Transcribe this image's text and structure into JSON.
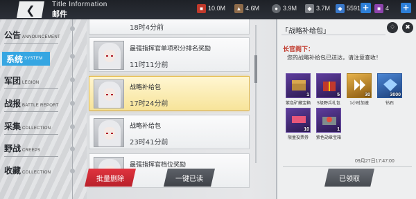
{
  "header": {
    "title_en": "Title Information",
    "title_cn": "邮件",
    "resources": [
      {
        "name": "resource-1",
        "value": "10.0M",
        "icon": "fuel-icon",
        "color": "#c0392b"
      },
      {
        "name": "resource-2",
        "value": "4.6M",
        "icon": "ammo-icon",
        "color": "#8e6b4a"
      },
      {
        "name": "resource-3",
        "value": "3.9M",
        "icon": "steel-icon",
        "color": "#666a70"
      },
      {
        "name": "resource-4",
        "value": "3.7M",
        "icon": "alloy-icon",
        "color": "#7c7f85"
      },
      {
        "name": "resource-5",
        "value": "5591",
        "icon": "crystal-icon",
        "color": "#3a78c9"
      },
      {
        "name": "resource-6",
        "value": "4",
        "icon": "ticket-icon",
        "color": "#8e44ad"
      }
    ]
  },
  "menu": {
    "items": [
      {
        "cn": "公告",
        "en": "ANNOUNCEMENT"
      },
      {
        "cn": "系统",
        "en": "SYSTEM"
      },
      {
        "cn": "军团",
        "en": "LEGION"
      },
      {
        "cn": "战报",
        "en": "BATTLE REPORT"
      },
      {
        "cn": "采集",
        "en": "COLLECTION"
      },
      {
        "cn": "野战",
        "en": "CREEPS"
      },
      {
        "cn": "收藏",
        "en": "COLLECTION"
      }
    ],
    "active_index": 1
  },
  "mails": [
    {
      "subject": "",
      "time": "18时4分前"
    },
    {
      "subject": "最强指挥官单项积分排名奖励",
      "time": "11时11分前"
    },
    {
      "subject": "战略补给包",
      "time": "17时24分前"
    },
    {
      "subject": "战略补给包",
      "time": "23时41分前"
    },
    {
      "subject": "最强指挥官档位奖励",
      "time": ""
    }
  ],
  "buttons": {
    "batch_delete": "批量删除",
    "read_all": "一键已读",
    "claimed": "已领取"
  },
  "detail": {
    "title": "「战略补给包」",
    "greeting": "长官阁下：",
    "body": "您的战略补给包已送达，请注意查收！",
    "date": "09月27日17:47:00",
    "rewards": [
      {
        "label": "紫色矿藏宝箱",
        "qty": "1",
        "style": "purple"
      },
      {
        "label": "5级野兵礼包",
        "qty": "5",
        "style": "purple"
      },
      {
        "label": "1小时加速",
        "qty": "30",
        "style": "purple"
      },
      {
        "label": "钻石",
        "qty": "3000",
        "style": "blue"
      },
      {
        "label": "限量投票券",
        "qty": "10",
        "style": "purple"
      },
      {
        "label": "紫色勋章宝箱",
        "qty": "1",
        "style": "purple"
      }
    ]
  }
}
